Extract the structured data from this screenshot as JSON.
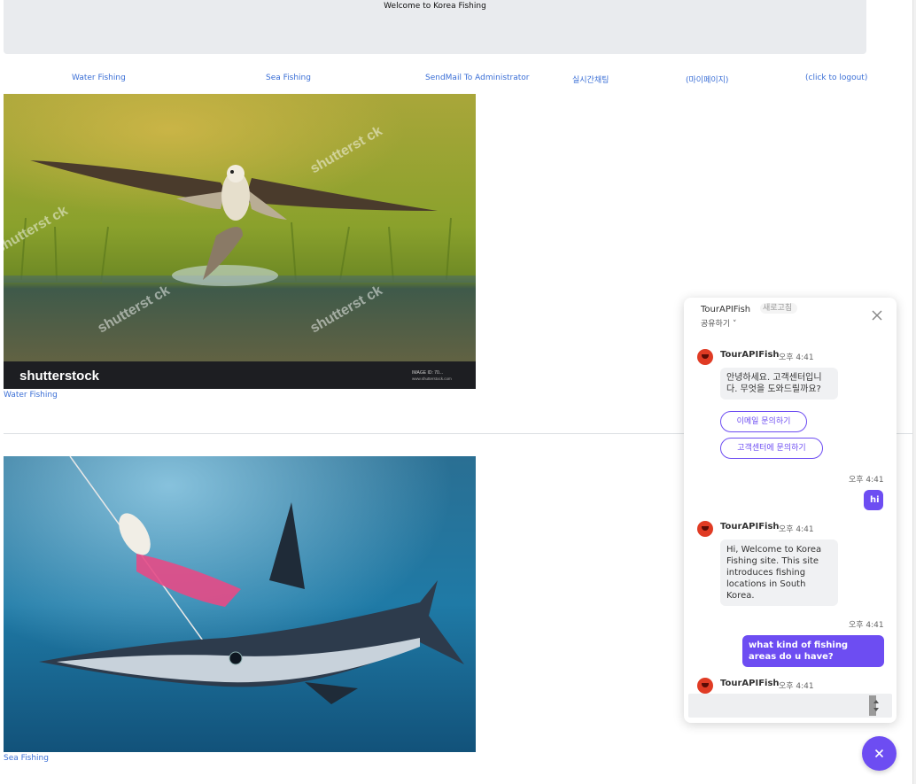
{
  "header": {
    "title": "Welcome to Korea Fishing"
  },
  "nav": {
    "water_fishing": "Water Fishing",
    "sea_fishing": "Sea Fishing",
    "sendmail": "SendMail To Administrator",
    "realtime_chat": "실시간채팅",
    "mypage": "(마이페이지)",
    "logout": "(click to logout)"
  },
  "gallery": {
    "water": {
      "caption": "Water Fishing",
      "watermark_brand": "shutterstock",
      "watermark_text": "shutterst ck",
      "image_id": "IMAGE ID: 70...",
      "image_url": "www.shutterstock.com"
    },
    "sea": {
      "caption": "Sea Fishing"
    }
  },
  "chat": {
    "title": "TourAPIFish",
    "share": "공유하기 ˅",
    "refresh": "새로고침",
    "messages": [
      {
        "sender": "TourAPIFish",
        "time": "오후 4:41",
        "text": "안녕하세요. 고객센터입니다. 무엇을 도와드릴까요?"
      },
      {
        "time": "오후 4:41",
        "text": "hi"
      },
      {
        "sender": "TourAPIFish",
        "time": "오후 4:41",
        "text": "Hi, Welcome to Korea Fishing site. This site introduces fishing locations in South Korea."
      },
      {
        "time": "오후 4:41",
        "text": "what kind of fishing areas do u have?"
      },
      {
        "sender": "TourAPIFish",
        "time": "오후 4:41"
      }
    ],
    "chips": [
      "이메일 문의하기",
      "고객센터에 문의하기"
    ]
  },
  "colors": {
    "accent": "#6d4df2",
    "link": "#3b6fd6",
    "avatar": "#e03b24"
  },
  "icons": {
    "close": "close-icon",
    "fab": "close-icon",
    "avatar": "bot-avatar-icon"
  }
}
